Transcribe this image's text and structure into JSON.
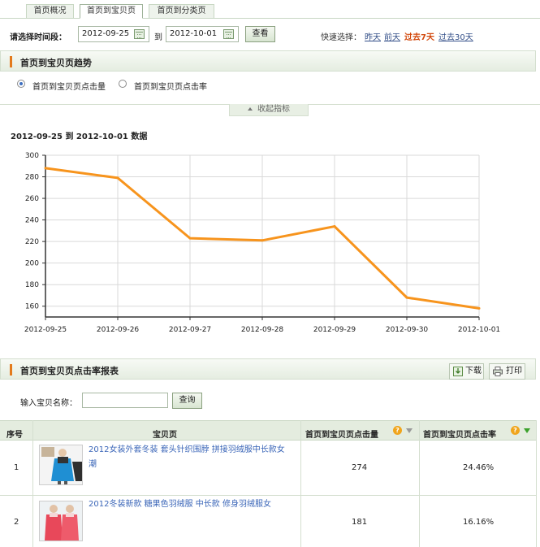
{
  "tabs": [
    {
      "label": "首页概况",
      "active": false
    },
    {
      "label": "首页到宝贝页",
      "active": true
    },
    {
      "label": "首页到分类页",
      "active": false
    }
  ],
  "datebar": {
    "label": "请选择时间段：",
    "start_date": "2012-09-25",
    "to_text": "到",
    "end_date": "2012-10-01",
    "query_button": "查看",
    "quick_label": "快速选择：",
    "quick_links": [
      {
        "label": "昨天",
        "active": false
      },
      {
        "label": "前天",
        "active": false
      },
      {
        "label": "过去7天",
        "active": true
      },
      {
        "label": "过去30天",
        "active": false
      }
    ]
  },
  "trend": {
    "title": "首页到宝贝页趋势",
    "radio_options": [
      {
        "label": "首页到宝贝页点击量",
        "checked": true
      },
      {
        "label": "首页到宝贝页点击率",
        "checked": false
      }
    ],
    "collapse_label": "收起指标",
    "collapse_icon": "chevron-up-icon",
    "range_text": "2012-09-25 到  2012-10-01 数据"
  },
  "chart_data": {
    "type": "line",
    "title": "",
    "x": [
      "2012-09-25",
      "2012-09-26",
      "2012-09-27",
      "2012-09-28",
      "2012-09-29",
      "2012-09-30",
      "2012-10-01"
    ],
    "series": [
      {
        "name": "",
        "values": [
          288,
          279,
          223,
          221,
          234,
          168,
          158
        ],
        "color": "#f7941d"
      }
    ],
    "ylim": [
      150,
      300
    ],
    "yticks": [
      160,
      180,
      200,
      220,
      240,
      260,
      280,
      300
    ],
    "xlabel": "",
    "ylabel": "",
    "grid": true,
    "legend": "none"
  },
  "report": {
    "title": "首页到宝贝页点击率报表",
    "download_label": "下载",
    "print_label": "打印",
    "search_label": "输入宝贝名称：",
    "search_value": "",
    "search_button": "查询",
    "columns": [
      "序号",
      "宝贝页",
      "首页到宝贝页点击量",
      "首页到宝贝页点击率"
    ],
    "rows": [
      {
        "index": "1",
        "title": "2012女装外套冬装 套头针织围脖 拼接羽绒服中长款女 潮",
        "clicks": "274",
        "rate": "24.46%"
      },
      {
        "index": "2",
        "title": "2012冬装新款 糖果色羽绒服 中长款 修身羽绒服女",
        "clicks": "181",
        "rate": "16.16%"
      }
    ]
  },
  "colors": {
    "accent": "#e37a1c",
    "line": "#f7941d",
    "link": "#3b66b8",
    "active_quick": "#d2480c"
  }
}
